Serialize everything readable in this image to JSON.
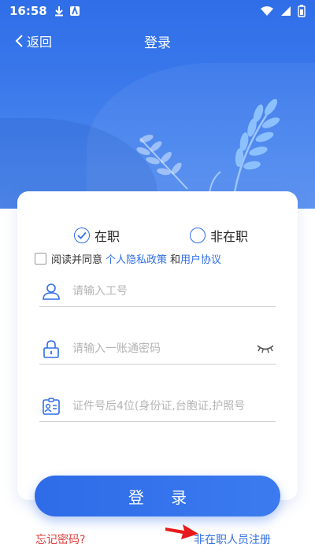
{
  "status_bar": {
    "time": "16:58"
  },
  "nav": {
    "back_label": "返回",
    "title": "登录"
  },
  "employment": {
    "options": [
      {
        "label": "在职",
        "selected": true
      },
      {
        "label": "非在职",
        "selected": false
      }
    ]
  },
  "form": {
    "employee_id": {
      "placeholder": "请输入工号",
      "value": ""
    },
    "password": {
      "placeholder": "请输入一账通密码",
      "value": ""
    },
    "id_suffix": {
      "placeholder": "证件号后4位(身份证,台胞证,护照号",
      "value": ""
    }
  },
  "agreement": {
    "prefix": "阅读并同意",
    "privacy_link": "个人隐私政策",
    "conjunction": "和",
    "terms_link": "用户协议",
    "checked": false
  },
  "login_button": "登 录",
  "links": {
    "forgot_password": "忘记密码?",
    "register": "非在职人员注册"
  },
  "colors": {
    "primary": "#2f6ee8",
    "danger": "#e23c3c",
    "arrow": "#e8191a"
  },
  "icons": [
    "download-icon",
    "app-badge-icon",
    "wifi-icon",
    "signal-icon",
    "battery-icon",
    "chevron-left-icon",
    "check-icon",
    "user-icon",
    "lock-icon",
    "eye-closed-icon",
    "id-card-icon"
  ]
}
